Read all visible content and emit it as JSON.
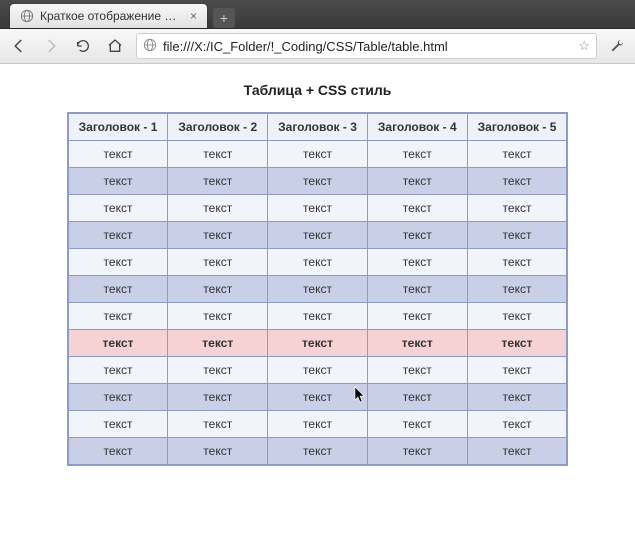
{
  "browser": {
    "tab_title": "Краткое отображение зака",
    "url": "file:///X:/IC_Folder/!_Coding/CSS/Table/table.html"
  },
  "page": {
    "caption": "Таблица + CSS стиль",
    "headers": [
      "Заголовок - 1",
      "Заголовок - 2",
      "Заголовок - 3",
      "Заголовок - 4",
      "Заголовок - 5"
    ],
    "cell": "текст",
    "rows": 12,
    "cols": 5,
    "hover_row_index": 7
  }
}
